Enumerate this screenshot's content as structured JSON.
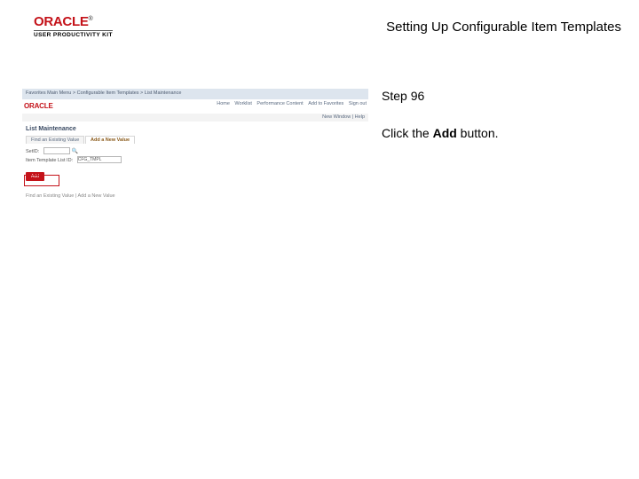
{
  "header": {
    "brand_name": "ORACLE",
    "brand_sub": "USER PRODUCTIVITY KIT",
    "title": "Setting Up Configurable Item Templates"
  },
  "instruction": {
    "step_label": "Step 96",
    "text_before": "Click the ",
    "text_bold": "Add",
    "text_after": " button."
  },
  "screenshot": {
    "breadcrumb": "Favorites    Main Menu  >  Configurable Item Templates  >  List Maintenance",
    "logo": "ORACLE",
    "top_tabs": [
      "Home",
      "Worklist",
      "Performance Content",
      "Add to Favorites",
      "Sign out"
    ],
    "subnav": "New Window | Help",
    "page_title": "List Maintenance",
    "tabs": {
      "inactive": "Find an Existing Value",
      "active": "Add a New Value"
    },
    "fields": {
      "setid_label": "SetID:",
      "setid_value": "",
      "tmpl_label": "Item Template List ID:",
      "tmpl_value": "CFG_TMPL"
    },
    "add_button": "Add",
    "footer": "Find an Existing Value  |  Add a New Value"
  }
}
